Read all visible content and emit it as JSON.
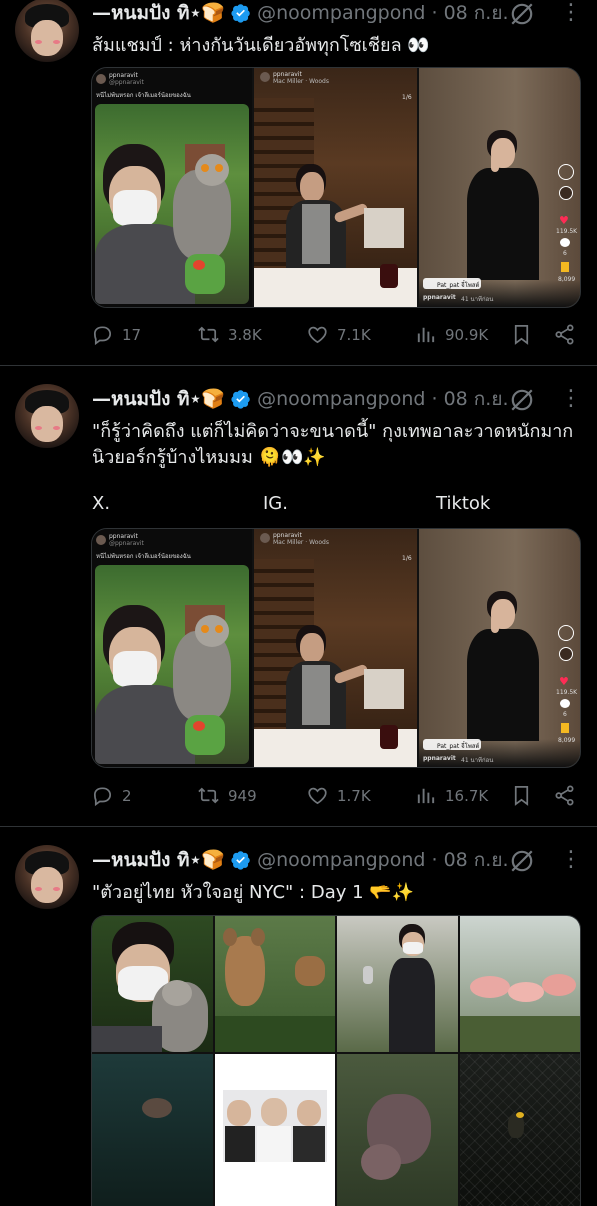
{
  "tweets": [
    {
      "name": "—หนมปัง ทิ⋆🍞",
      "handle": "@noompangpond",
      "date": "· 08 ก.ย.",
      "text": "ส้มแชมป์ : ห่างกันวันเดียวอัพทุกโซเชียล 👀",
      "media": {
        "x_post_user": "ppnaravit",
        "x_post_handle": "@ppnaravit",
        "x_post_caption": "หนีไม่พ้นหรอก เจ้าลีเมอร์น้อยของฉัน",
        "ig_user": "ppnaravit",
        "ig_music": "Mac Miller · Woods",
        "ig_counter": "1/6",
        "tt_likes": "119.5K",
        "tt_comments": "6",
        "tt_saves": "8,099",
        "tt_tag": "Pat_pat จี๋โพสต์",
        "tt_user": "ppnaravit",
        "tt_time": "41 นาทีก่อน"
      },
      "stats": {
        "replies": "17",
        "reposts": "3.8K",
        "likes": "7.1K",
        "views": "90.9K"
      }
    },
    {
      "name": "—หนมปัง ทิ⋆🍞",
      "handle": "@noompangpond",
      "date": "· 08 ก.ย.",
      "text_line1": "\"ก็รู้ว่าคิดถึง แต่ก็ไม่คิดว่าจะขนาดนี้\" กุงเทพอาละวาดหนักมาก",
      "text_line2": "นิวยอร์กรู้บ้างไหมมม 🫠👀✨",
      "labels": [
        "X.",
        "IG.",
        "Tiktok"
      ],
      "media": {
        "x_post_user": "ppnaravit",
        "x_post_handle": "@ppnaravit",
        "x_post_caption": "หนีไม่พ้นหรอก เจ้าลีเมอร์น้อยของฉัน",
        "ig_user": "ppnaravit",
        "ig_music": "Mac Miller · Woods",
        "ig_counter": "1/6",
        "tt_likes": "119.5K",
        "tt_comments": "6",
        "tt_saves": "8,099",
        "tt_tag": "Pat_pat จี๋โพสต์",
        "tt_user": "ppnaravit",
        "tt_time": "41 นาทีก่อน"
      },
      "stats": {
        "replies": "2",
        "reposts": "949",
        "likes": "1.7K",
        "views": "16.7K"
      }
    },
    {
      "name": "—หนมปัง ทิ⋆🍞",
      "handle": "@noompangpond",
      "date": "· 08 ก.ย.",
      "text": "\"ตัวอยู่ไทย หัวใจอยู่ NYC\" : Day 1 🫳✨"
    }
  ],
  "colors": {
    "background": "#000000",
    "text": "#e7e9ea",
    "muted": "#71767b",
    "divider": "#2f3336",
    "verified": "#1d9bf0"
  }
}
